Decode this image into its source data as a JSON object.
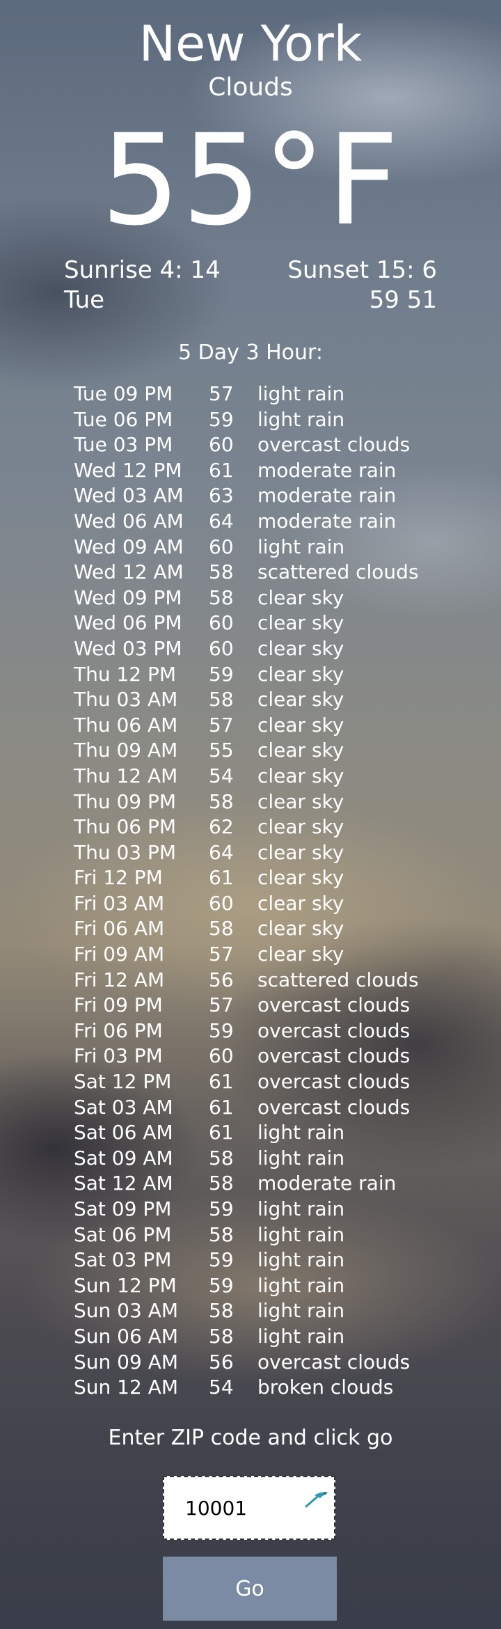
{
  "header": {
    "city": "New York",
    "condition": "Clouds",
    "temperature": "55°F",
    "sunrise": "Sunrise 4: 14",
    "sunset": "Sunset 15: 6",
    "day": "Tue",
    "hi_lo": "59 51"
  },
  "forecast": {
    "title": "5 Day 3 Hour:",
    "rows": [
      {
        "time": "Tue 09 PM",
        "temp": "57",
        "desc": "light rain"
      },
      {
        "time": "Tue 06 PM",
        "temp": "59",
        "desc": "light rain"
      },
      {
        "time": "Tue 03 PM",
        "temp": "60",
        "desc": "overcast clouds"
      },
      {
        "time": "Wed 12 PM",
        "temp": "61",
        "desc": "moderate rain"
      },
      {
        "time": "Wed 03 AM",
        "temp": "63",
        "desc": "moderate rain"
      },
      {
        "time": "Wed 06 AM",
        "temp": "64",
        "desc": "moderate rain"
      },
      {
        "time": "Wed 09 AM",
        "temp": "60",
        "desc": "light rain"
      },
      {
        "time": "Wed 12 AM",
        "temp": "58",
        "desc": "scattered clouds"
      },
      {
        "time": "Wed 09 PM",
        "temp": "58",
        "desc": "clear sky"
      },
      {
        "time": "Wed 06 PM",
        "temp": "60",
        "desc": "clear sky"
      },
      {
        "time": "Wed 03 PM",
        "temp": "60",
        "desc": "clear sky"
      },
      {
        "time": "Thu 12 PM",
        "temp": "59",
        "desc": "clear sky"
      },
      {
        "time": "Thu 03 AM",
        "temp": "58",
        "desc": "clear sky"
      },
      {
        "time": "Thu 06 AM",
        "temp": "57",
        "desc": "clear sky"
      },
      {
        "time": "Thu 09 AM",
        "temp": "55",
        "desc": "clear sky"
      },
      {
        "time": "Thu 12 AM",
        "temp": "54",
        "desc": "clear sky"
      },
      {
        "time": "Thu 09 PM",
        "temp": "58",
        "desc": "clear sky"
      },
      {
        "time": "Thu 06 PM",
        "temp": "62",
        "desc": "clear sky"
      },
      {
        "time": "Thu 03 PM",
        "temp": "64",
        "desc": "clear sky"
      },
      {
        "time": "Fri 12 PM",
        "temp": "61",
        "desc": "clear sky"
      },
      {
        "time": "Fri 03 AM",
        "temp": "60",
        "desc": "clear sky"
      },
      {
        "time": "Fri 06 AM",
        "temp": "58",
        "desc": "clear sky"
      },
      {
        "time": "Fri 09 AM",
        "temp": "57",
        "desc": "clear sky"
      },
      {
        "time": "Fri 12 AM",
        "temp": "56",
        "desc": "scattered clouds"
      },
      {
        "time": "Fri 09 PM",
        "temp": "57",
        "desc": "overcast clouds"
      },
      {
        "time": "Fri 06 PM",
        "temp": "59",
        "desc": "overcast clouds"
      },
      {
        "time": "Fri 03 PM",
        "temp": "60",
        "desc": "overcast clouds"
      },
      {
        "time": "Sat 12 PM",
        "temp": "61",
        "desc": "overcast clouds"
      },
      {
        "time": "Sat 03 AM",
        "temp": "61",
        "desc": "overcast clouds"
      },
      {
        "time": "Sat 06 AM",
        "temp": "61",
        "desc": "light rain"
      },
      {
        "time": "Sat 09 AM",
        "temp": "58",
        "desc": "light rain"
      },
      {
        "time": "Sat 12 AM",
        "temp": "58",
        "desc": "moderate rain"
      },
      {
        "time": "Sat 09 PM",
        "temp": "59",
        "desc": "light rain"
      },
      {
        "time": "Sat 06 PM",
        "temp": "58",
        "desc": "light rain"
      },
      {
        "time": "Sat 03 PM",
        "temp": "59",
        "desc": "light rain"
      },
      {
        "time": "Sun 12 PM",
        "temp": "59",
        "desc": "light rain"
      },
      {
        "time": "Sun 03 AM",
        "temp": "58",
        "desc": "light rain"
      },
      {
        "time": "Sun 06 AM",
        "temp": "58",
        "desc": "light rain"
      },
      {
        "time": "Sun 09 AM",
        "temp": "56",
        "desc": "overcast clouds"
      },
      {
        "time": "Sun 12 AM",
        "temp": "54",
        "desc": "broken clouds"
      }
    ]
  },
  "zip": {
    "prompt": "Enter ZIP code and click go",
    "value": "10001",
    "icon": "autofill-key-icon",
    "go_label": "Go"
  },
  "colors": {
    "text": "#ffffff",
    "button": "#7b8ba3",
    "input_bg": "#ffffff"
  }
}
